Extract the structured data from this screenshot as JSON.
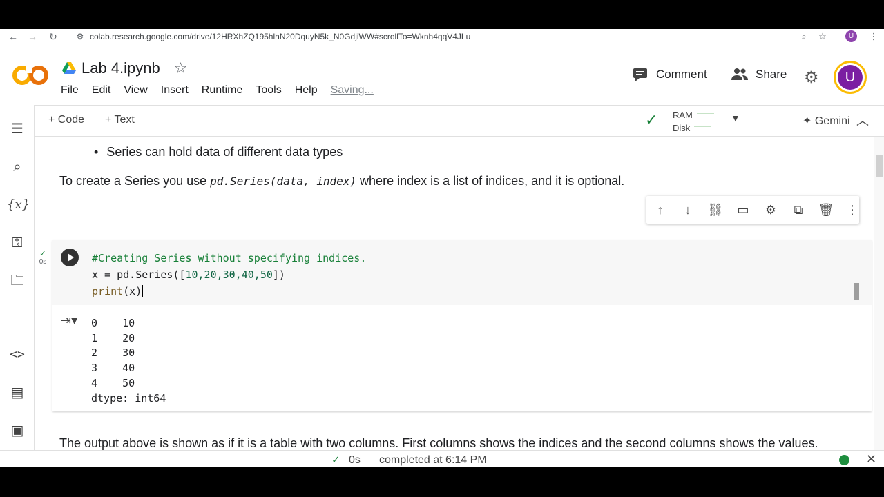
{
  "browser": {
    "url": "colab.research.google.com/drive/12HRXhZQ195hlhN20DquyN5k_N0GdjiWW#scrollTo=Wknh4qqV4JLu",
    "profile_initial": "U"
  },
  "header": {
    "notebook_title": "Lab 4.ipynb",
    "menu": [
      "File",
      "Edit",
      "View",
      "Insert",
      "Runtime",
      "Tools",
      "Help"
    ],
    "saving_label": "Saving...",
    "comment_label": "Comment",
    "share_label": "Share",
    "avatar_initial": "U"
  },
  "toolbar": {
    "add_code_label": "+ Code",
    "add_text_label": "+ Text",
    "ram_label": "RAM",
    "disk_label": "Disk",
    "gemini_label": "Gemini"
  },
  "content": {
    "bullet": "Series can hold data of different data types",
    "para1_before": "To create a Series you use ",
    "para1_code": "pd.Series(data, index)",
    "para1_after": " where index is a list of indices, and it is optional.",
    "code_line1": "#Creating Series without specifying indices.",
    "code_line2_a": "x = pd.Series([",
    "code_line2_nums": "10,20,30,40,50",
    "code_line2_b": "])",
    "code_line3_fn": "print",
    "code_line3_arg": "(x)",
    "cell_status_time": "0s",
    "output_text": "0    10\n1    20\n2    30\n3    40\n4    50\ndtype: int64",
    "para2": "The output above is shown as if it is a table with two columns. First columns shows the indices and the second columns shows the values."
  },
  "statusbar": {
    "time": "0s",
    "completed": "completed at 6:14 PM"
  },
  "colors": {
    "accent_orange": "#f9ab00",
    "comment_green": "#188038",
    "status_green": "#1e8e3e"
  }
}
